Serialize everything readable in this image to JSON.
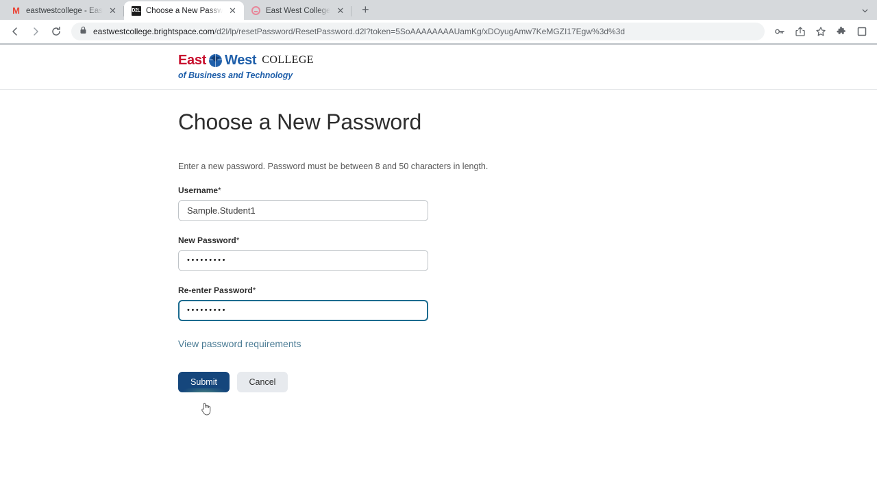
{
  "browser": {
    "tabs": [
      {
        "title": "eastwestcollege - EastWestColleg",
        "favicon": "gmail-icon",
        "active": false
      },
      {
        "title": "Choose a New Password - EastW",
        "favicon": "d2l-icon",
        "active": true
      },
      {
        "title": "East West College",
        "favicon": "circle-icon",
        "active": false
      }
    ],
    "new_tab_label": "+",
    "tab_search_icon": "chevron-down-icon",
    "toolbar": {
      "back_icon": "back-arrow-icon",
      "forward_icon": "forward-arrow-icon",
      "reload_icon": "reload-icon",
      "lock_icon": "lock-icon",
      "url": "eastwestcollege.brightspace.com/d2l/lp/resetPassword/ResetPassword.d2l?token=5SoAAAAAAAAUamKg/xDOyugAmw7KeMGZI17Egw%3d%3d",
      "url_host": "eastwestcollege.brightspace.com",
      "url_path": "/d2l/lp/resetPassword/ResetPassword.d2l?token=5SoAAAAAAAAUamKg/xDOyugAmw7KeMGZI17Egw%3d%3d",
      "right_icons": [
        "key-icon",
        "share-icon",
        "bookmark-star-icon",
        "extensions-puzzle-icon",
        "profile-icon"
      ]
    }
  },
  "site": {
    "logo": {
      "east": "East",
      "west": "West",
      "college": "COLLEGE",
      "tagline": "of Business and Technology",
      "globe_icon": "globe-icon"
    }
  },
  "page": {
    "title": "Choose a New Password",
    "intro": "Enter a new password.  Password must be between 8 and 50 characters in length.",
    "fields": [
      {
        "label": "Username",
        "required_marker": "*",
        "value": "Sample.Student1",
        "type": "text"
      },
      {
        "label": "New Password",
        "required_marker": "*",
        "value": "•••••••••",
        "type": "password"
      },
      {
        "label": "Re-enter Password",
        "required_marker": "*",
        "value": "•••••••••",
        "type": "password",
        "focused": true
      }
    ],
    "requirements_link": "View password requirements",
    "submit_label": "Submit",
    "cancel_label": "Cancel"
  },
  "colors": {
    "brand_red": "#c8102e",
    "brand_blue": "#1f5faa",
    "primary_button": "#15467c",
    "focus_border": "#1b6b8f",
    "link": "#4a7b94",
    "click_glow": "#dfff3c"
  }
}
